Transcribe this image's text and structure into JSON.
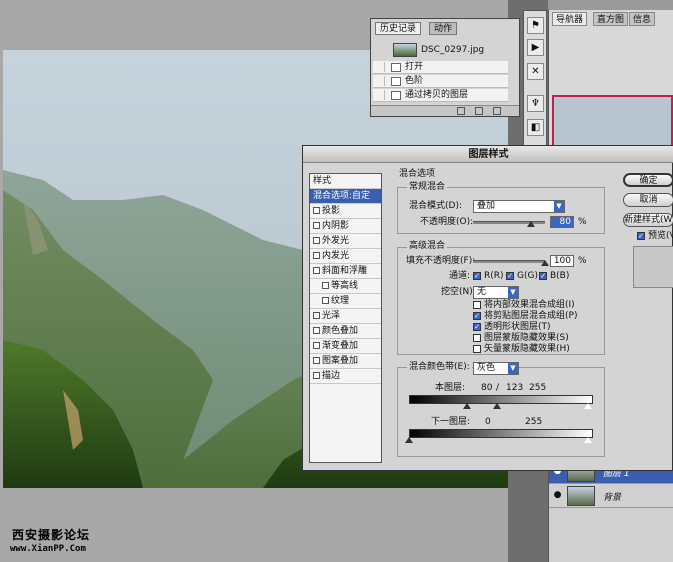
{
  "history_panel": {
    "tabs": [
      "历史记录",
      "动作"
    ],
    "snapshot_name": "DSC_0297.jpg",
    "items": [
      "打开",
      "色阶",
      "通过拷贝的图层"
    ]
  },
  "navigator_panel": {
    "tabs": [
      "导航器",
      "直方图",
      "信息"
    ]
  },
  "layers_panel": {
    "layers": [
      {
        "name": "图层 1",
        "selected": true
      },
      {
        "name": "背景",
        "selected": false
      }
    ]
  },
  "dialog": {
    "title": "图层样式",
    "style_list": [
      {
        "label": "样式",
        "checkbox": false,
        "selected": false,
        "indent": false
      },
      {
        "label": "混合选项:自定",
        "checkbox": false,
        "selected": true,
        "indent": false
      },
      {
        "label": "投影",
        "checkbox": true,
        "selected": false,
        "indent": false
      },
      {
        "label": "内阴影",
        "checkbox": true,
        "selected": false,
        "indent": false
      },
      {
        "label": "外发光",
        "checkbox": true,
        "selected": false,
        "indent": false
      },
      {
        "label": "内发光",
        "checkbox": true,
        "selected": false,
        "indent": false
      },
      {
        "label": "斜面和浮雕",
        "checkbox": true,
        "selected": false,
        "indent": false
      },
      {
        "label": "等高线",
        "checkbox": true,
        "selected": false,
        "indent": true
      },
      {
        "label": "纹理",
        "checkbox": true,
        "selected": false,
        "indent": true
      },
      {
        "label": "光泽",
        "checkbox": true,
        "selected": false,
        "indent": false
      },
      {
        "label": "颜色叠加",
        "checkbox": true,
        "selected": false,
        "indent": false
      },
      {
        "label": "渐变叠加",
        "checkbox": true,
        "selected": false,
        "indent": false
      },
      {
        "label": "图案叠加",
        "checkbox": true,
        "selected": false,
        "indent": false
      },
      {
        "label": "描边",
        "checkbox": true,
        "selected": false,
        "indent": false
      }
    ],
    "blend_options_title": "混合选项",
    "general": {
      "title": "常规混合",
      "blend_mode_label": "混合模式(D):",
      "blend_mode_value": "叠加",
      "opacity_label": "不透明度(O):",
      "opacity_value": "80",
      "opacity_fraction": 0.8,
      "unit": "%"
    },
    "advanced": {
      "title": "高级混合",
      "fill_opacity_label": "填充不透明度(F):",
      "fill_opacity_value": "100",
      "fill_opacity_fraction": 1.0,
      "unit": "%",
      "channels_label": "通道:",
      "channels": [
        "R(R)",
        "G(G)",
        "B(B)"
      ],
      "knockout_label": "挖空(N):",
      "knockout_value": "无",
      "options": [
        {
          "label": "将内部效果混合成组(I)",
          "checked": false
        },
        {
          "label": "将剪贴图层混合成组(P)",
          "checked": true
        },
        {
          "label": "透明形状图层(T)",
          "checked": true
        },
        {
          "label": "图层蒙版隐藏效果(S)",
          "checked": false
        },
        {
          "label": "矢量蒙版隐藏效果(H)",
          "checked": false
        }
      ]
    },
    "blend_if": {
      "label": "混合颜色带(E):",
      "value": "灰色",
      "this_layer_label": "本图层:",
      "this_layer_values": [
        "80",
        "/",
        "123",
        "255"
      ],
      "below_layer_label": "下一图层:",
      "below_layer_values": [
        "0",
        "255"
      ]
    },
    "buttons": {
      "ok": "确定",
      "cancel": "取消",
      "new_style": "新建样式(W)...",
      "preview": "预览(V)"
    }
  },
  "watermark": {
    "line1": "西安摄影论坛",
    "line2": "www.XianPP.Com"
  },
  "colors": {
    "selection_blue": "#3a5fae",
    "navigator_frame": "#c02050"
  }
}
